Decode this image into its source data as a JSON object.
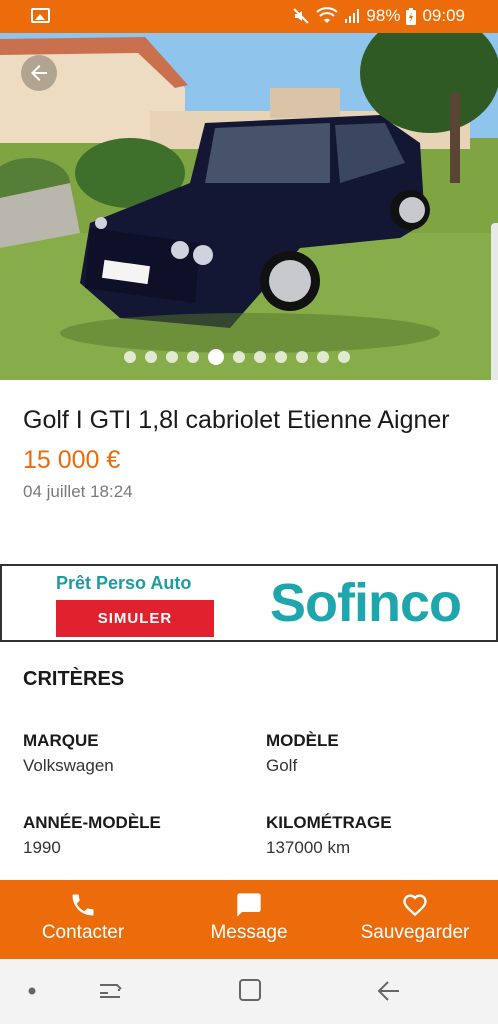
{
  "status_bar": {
    "battery": "98%",
    "time": "09:09"
  },
  "listing": {
    "title": "Golf I GTI 1,8l cabriolet Etienne Aigner",
    "price": "15 000 €",
    "date": "04 juillet 18:24",
    "gallery": {
      "count": 11,
      "active_index": 4
    }
  },
  "ad": {
    "headline": "Prêt Perso Auto",
    "button": "SIMULER",
    "brand": "Sofinco"
  },
  "criteria": {
    "heading": "CRITÈRES",
    "items": [
      {
        "label": "MARQUE",
        "value": "Volkswagen"
      },
      {
        "label": "MODÈLE",
        "value": "Golf"
      },
      {
        "label": "ANNÉE-MODÈLE",
        "value": "1990"
      },
      {
        "label": "KILOMÉTRAGE",
        "value": "137000 km"
      }
    ]
  },
  "actions": {
    "contact": "Contacter",
    "message": "Message",
    "save": "Sauvegarder"
  },
  "colors": {
    "accent": "#ec6b0b",
    "ad_teal": "#1ea6ad",
    "ad_red": "#e0212e"
  },
  "icons": [
    "gallery-icon",
    "mute-icon",
    "wifi-icon",
    "signal-icon",
    "battery-icon",
    "back-arrow-icon",
    "phone-icon",
    "chat-icon",
    "heart-icon",
    "recents-icon",
    "home-icon",
    "nav-back-icon"
  ]
}
